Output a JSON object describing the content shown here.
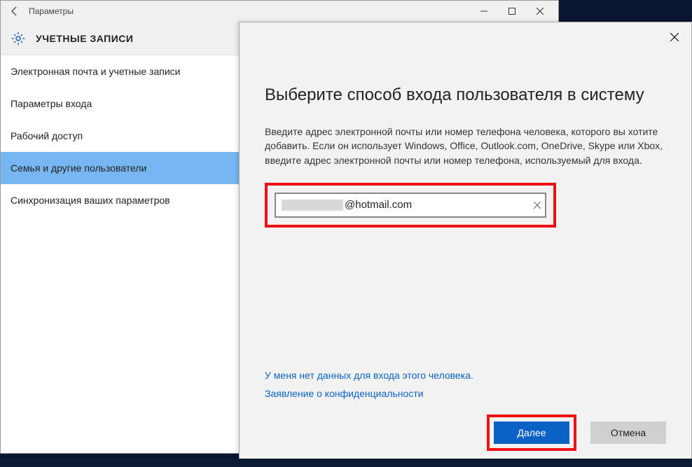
{
  "settings": {
    "window_title": "Параметры",
    "section_title": "УЧЕТНЫЕ ЗАПИСИ",
    "sidebar": [
      {
        "label": "Электронная почта и учетные записи",
        "active": false
      },
      {
        "label": "Параметры входа",
        "active": false
      },
      {
        "label": "Рабочий доступ",
        "active": false
      },
      {
        "label": "Семья и другие пользователи",
        "active": true
      },
      {
        "label": "Синхронизация ваших параметров",
        "active": false
      }
    ]
  },
  "dialog": {
    "title": "Выберите способ входа пользователя в систему",
    "description": "Введите адрес электронной почты или номер телефона человека, которого вы хотите добавить. Если он использует Windows, Office, Outlook.com, OneDrive, Skype или Xbox, введите адрес электронной почты или номер телефона, используемый для входа.",
    "email_value": "@hotmail.com",
    "links": {
      "no_credentials": "У меня нет данных для входа этого человека.",
      "privacy": "Заявление о конфиденциальности"
    },
    "buttons": {
      "next": "Далее",
      "cancel": "Отмена"
    }
  }
}
